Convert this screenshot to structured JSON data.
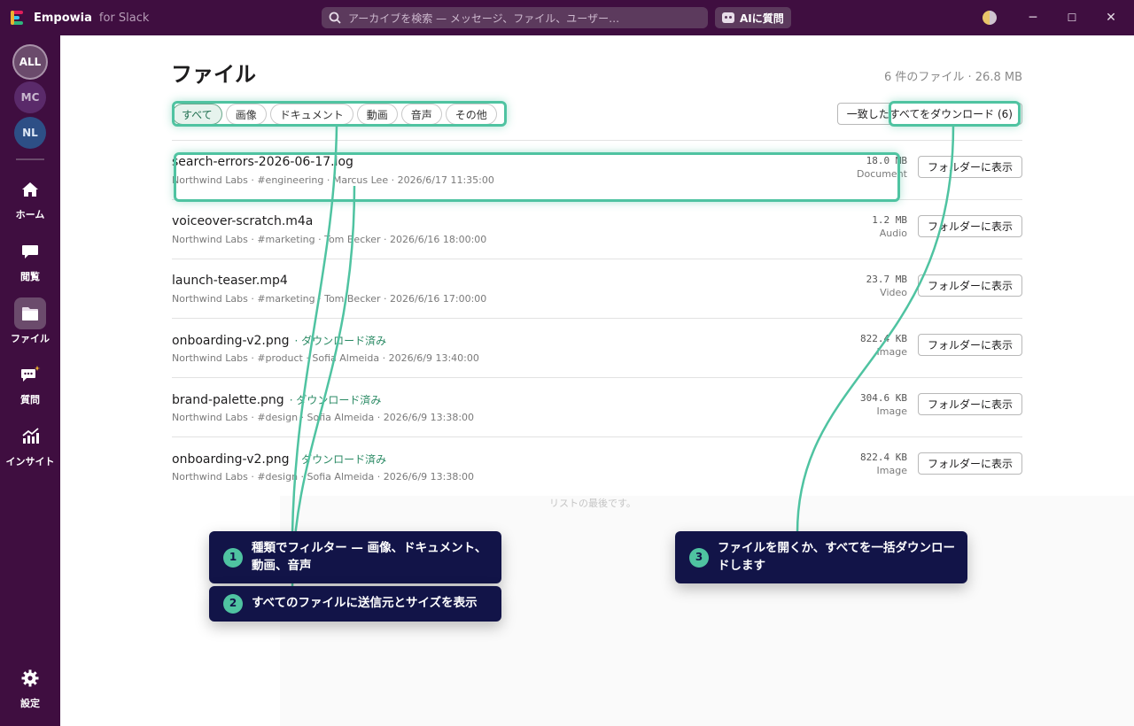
{
  "app": {
    "name": "Empowia",
    "suffix": "for Slack"
  },
  "search": {
    "placeholder": "アーカイブを検索 — メッセージ、ファイル、ユーザー…",
    "icon": "search-icon"
  },
  "ai_button": {
    "label": "AIに質問"
  },
  "window_controls": {
    "minimize": "─",
    "maximize": "☐",
    "close": "✕"
  },
  "workspaces": [
    "ALL",
    "MC",
    "NL"
  ],
  "nav": [
    {
      "label": "ホーム",
      "icon": "home-icon"
    },
    {
      "label": "閲覧",
      "icon": "chat-bubble-icon"
    },
    {
      "label": "ファイル",
      "icon": "folder-icon"
    },
    {
      "label": "質問",
      "icon": "ask-icon"
    },
    {
      "label": "インサイト",
      "icon": "insights-icon"
    },
    {
      "label": "設定",
      "icon": "gear-icon"
    }
  ],
  "page": {
    "title": "ファイル",
    "summary": "6 件のファイル · 26.8 MB",
    "download_all": "一致したすべてをダウンロード (6)",
    "end_note": "リストの最後です。"
  },
  "filters": [
    "すべて",
    "画像",
    "ドキュメント",
    "動画",
    "音声",
    "その他"
  ],
  "files": [
    {
      "name": "search-errors-2026-06-17.log",
      "downloaded": "",
      "meta": "Northwind Labs · #engineering · Marcus Lee · 2026/6/17 11:35:00",
      "size": "18.0 MB",
      "kind": "Document",
      "action": "フォルダーに表示"
    },
    {
      "name": "voiceover-scratch.m4a",
      "downloaded": "",
      "meta": "Northwind Labs · #marketing · Tom Becker · 2026/6/16 18:00:00",
      "size": "1.2 MB",
      "kind": "Audio",
      "action": "フォルダーに表示"
    },
    {
      "name": "launch-teaser.mp4",
      "downloaded": "",
      "meta": "Northwind Labs · #marketing · Tom Becker · 2026/6/16 17:00:00",
      "size": "23.7 MB",
      "kind": "Video",
      "action": "フォルダーに表示"
    },
    {
      "name": "onboarding-v2.png",
      "downloaded": "· ダウンロード済み",
      "meta": "Northwind Labs · #product · Sofia Almeida · 2026/6/9 13:40:00",
      "size": "822.4 KB",
      "kind": "Image",
      "action": "フォルダーに表示"
    },
    {
      "name": "brand-palette.png",
      "downloaded": "· ダウンロード済み",
      "meta": "Northwind Labs · #design · Sofia Almeida · 2026/6/9 13:38:00",
      "size": "304.6 KB",
      "kind": "Image",
      "action": "フォルダーに表示"
    },
    {
      "name": "onboarding-v2.png",
      "downloaded": "· ダウンロード済み",
      "meta": "Northwind Labs · #design · Sofia Almeida · 2026/6/9 13:38:00",
      "size": "822.4 KB",
      "kind": "Image",
      "action": "フォルダーに表示"
    }
  ],
  "callouts": [
    {
      "num": "1",
      "text": "種類でフィルター — 画像、ドキュメント、動画、音声"
    },
    {
      "num": "2",
      "text": "すべてのファイルに送信元とサイズを表示"
    },
    {
      "num": "3",
      "text": "ファイルを開くか、すべてを一括ダウンロードします"
    }
  ],
  "colors": {
    "sidebar": "#3f0e40",
    "accent": "#4fc3a1",
    "callout": "#121448",
    "downloaded": "#2a8a64"
  }
}
